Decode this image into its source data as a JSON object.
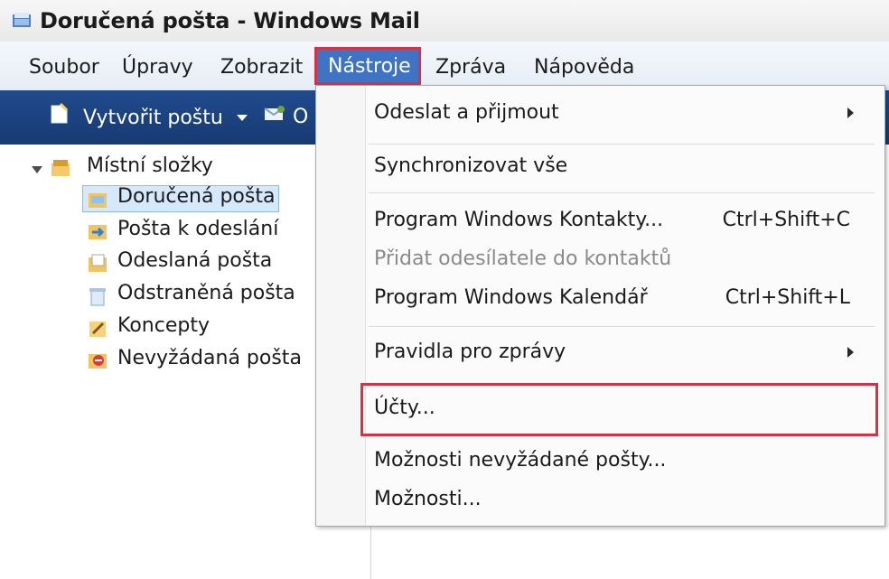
{
  "window": {
    "title": "Doručená pošta - Windows Mail"
  },
  "menu_bar": {
    "items": [
      "Soubor",
      "Úpravy",
      "Zobrazit",
      "Nástroje",
      "Zpráva",
      "Nápověda"
    ],
    "active_index": 3
  },
  "toolbar": {
    "create_mail_label": "Vytvořit poštu",
    "partial_label": "O"
  },
  "folders": {
    "root": "Místní složky",
    "items": [
      "Doručená pošta",
      "Pošta k odeslání",
      "Odeslaná pošta",
      "Odstraněná pošta",
      "Koncepty",
      "Nevyžádaná pošta"
    ],
    "selected_index": 0
  },
  "tools_menu": {
    "items": [
      {
        "label": "Odeslat a přijmout",
        "shortcut": "",
        "submenu": true,
        "disabled": false
      },
      {
        "label": "Synchronizovat vše",
        "shortcut": "",
        "submenu": false,
        "disabled": false
      },
      {
        "label": "Program Windows Kontakty...",
        "shortcut": "Ctrl+Shift+C",
        "submenu": false,
        "disabled": false
      },
      {
        "label": "Přidat odesílatele do kontaktů",
        "shortcut": "",
        "submenu": false,
        "disabled": true
      },
      {
        "label": "Program Windows Kalendář",
        "shortcut": "Ctrl+Shift+L",
        "submenu": false,
        "disabled": false
      },
      {
        "label": "Pravidla pro zprávy",
        "shortcut": "",
        "submenu": true,
        "disabled": false
      },
      {
        "label": "Účty...",
        "shortcut": "",
        "submenu": false,
        "disabled": false
      },
      {
        "label": "Možnosti nevyžádané pošty...",
        "shortcut": "",
        "submenu": false,
        "disabled": false
      },
      {
        "label": "Možnosti...",
        "shortcut": "",
        "submenu": false,
        "disabled": false
      }
    ]
  },
  "colors": {
    "accent": "#3f74c5",
    "highlight": "#d63145",
    "toolbar": "#1d4587"
  }
}
